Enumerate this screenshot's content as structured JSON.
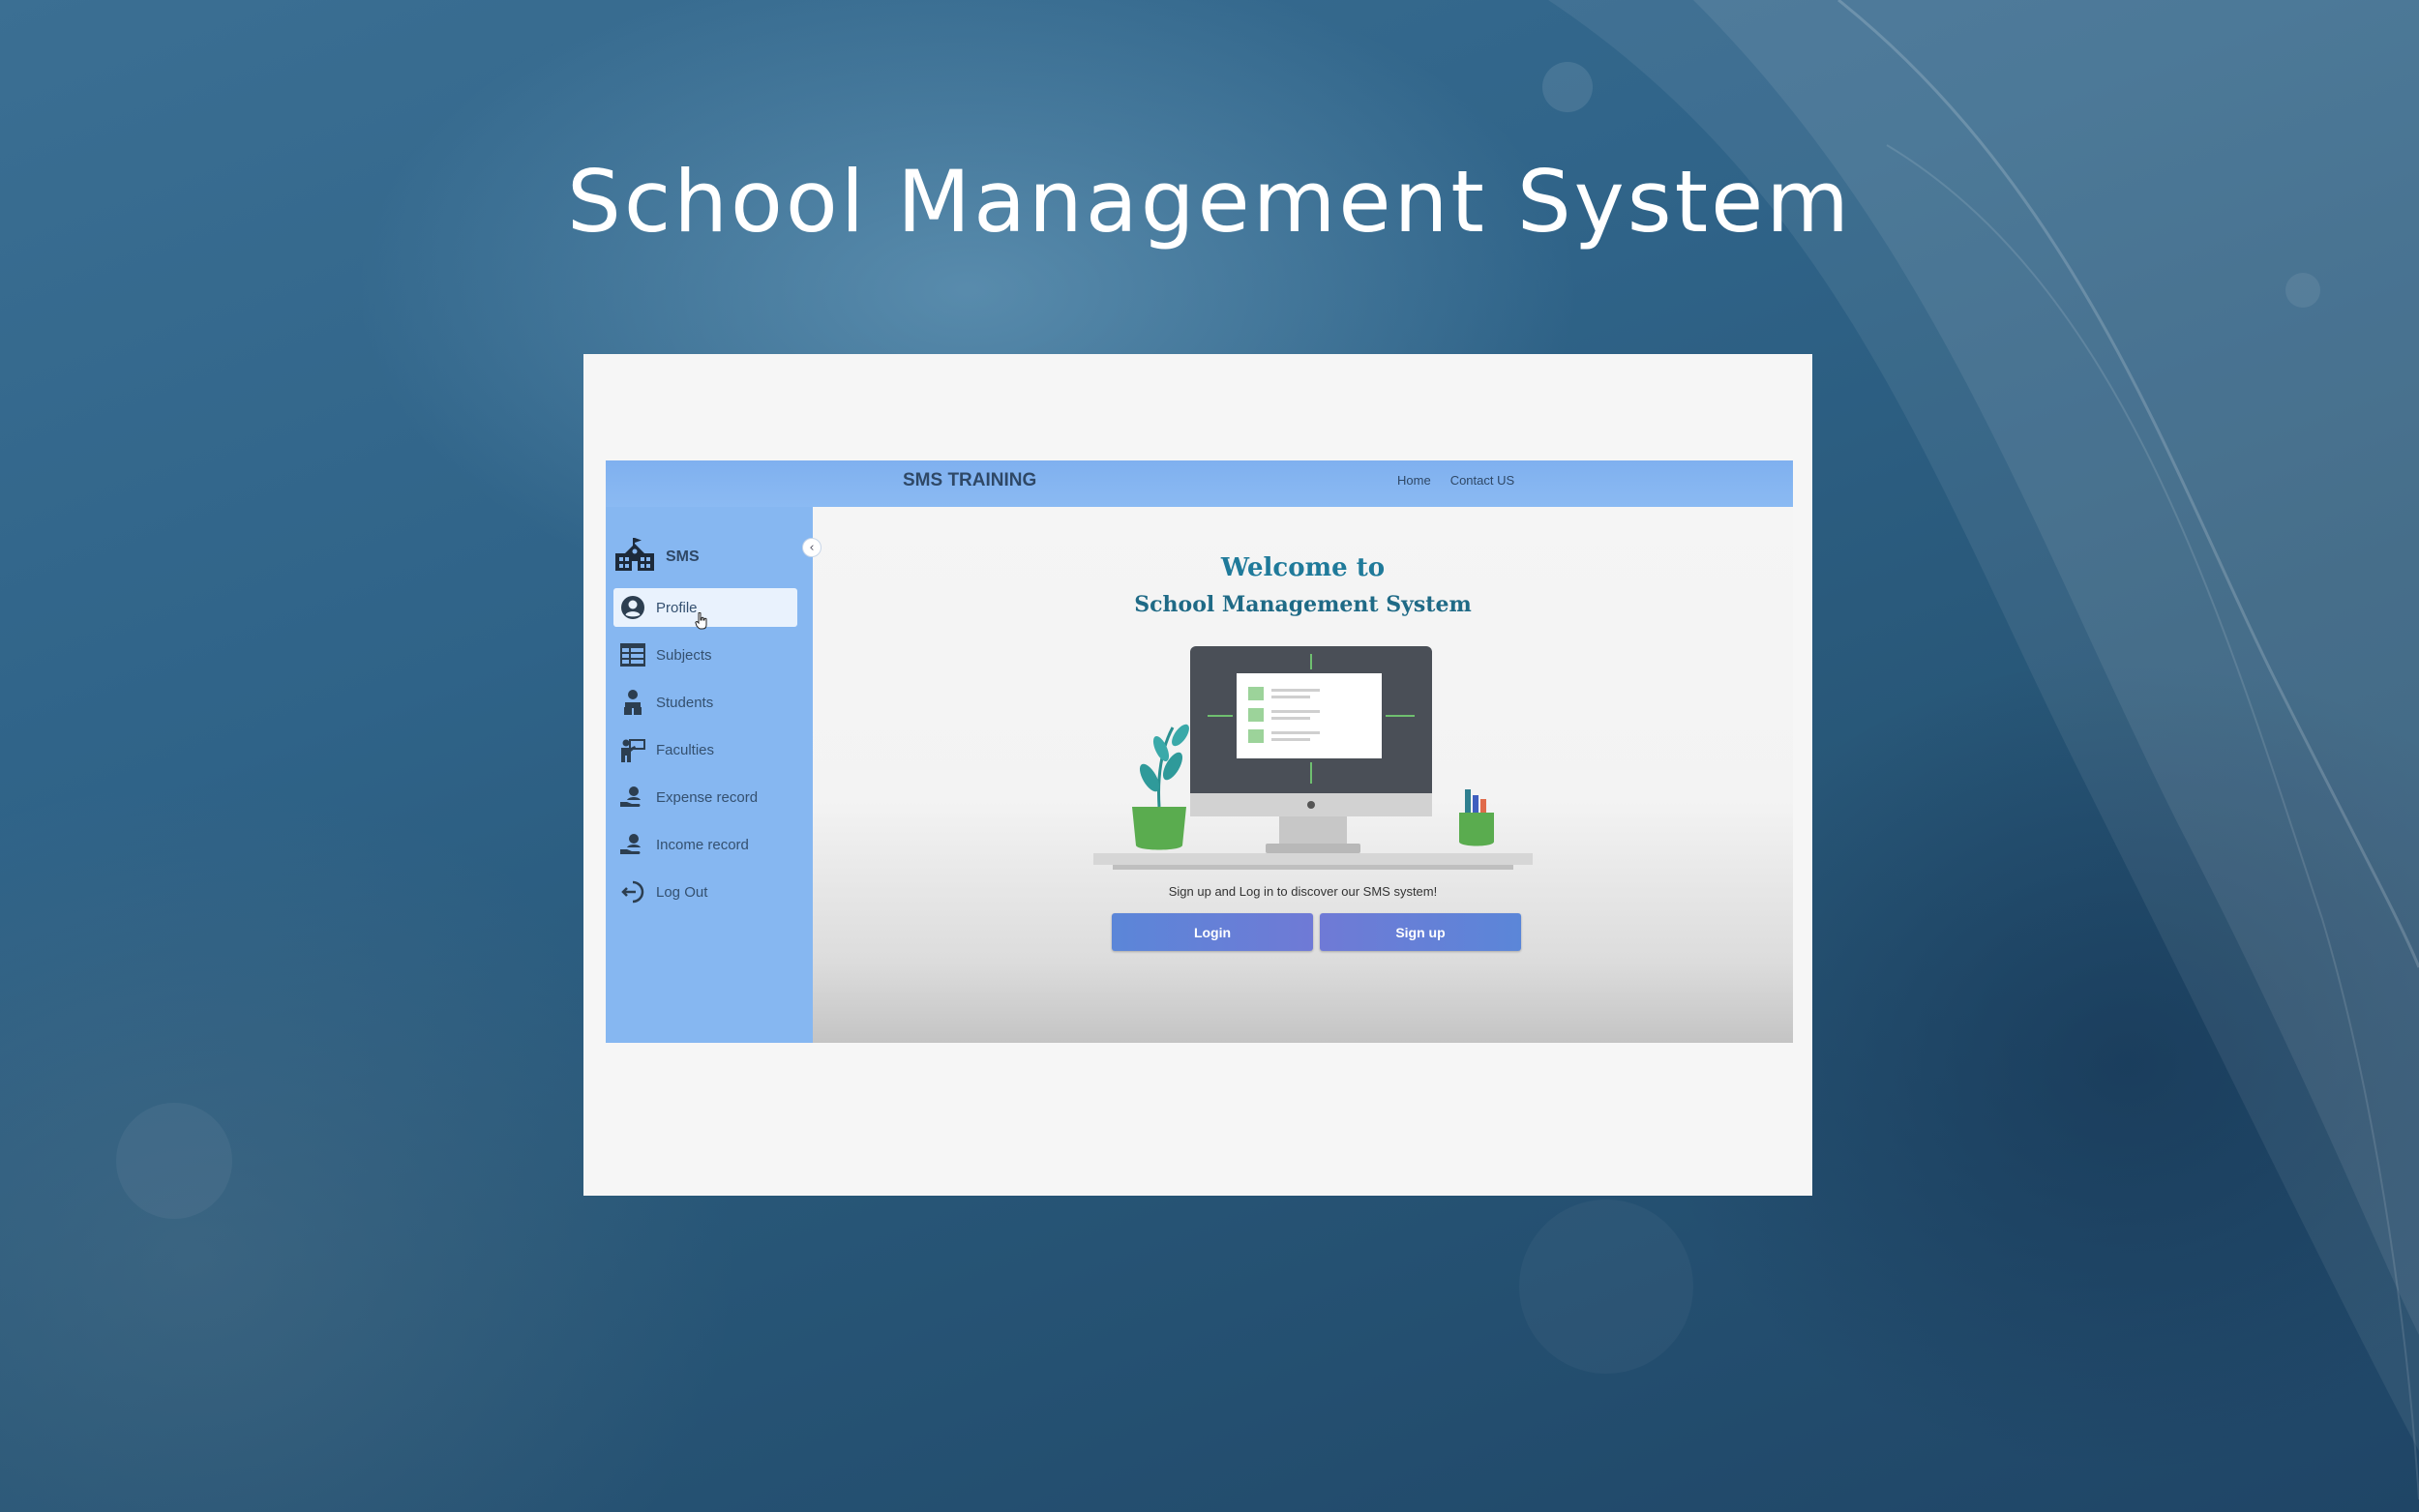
{
  "slide": {
    "title": "School Management System"
  },
  "app": {
    "brand": "SMS TRAINING",
    "nav": [
      "Home",
      "Contact US"
    ],
    "sidebar": {
      "logo_text": "SMS",
      "items": [
        {
          "label": "Profile",
          "icon": "user-circle-icon",
          "active": true
        },
        {
          "label": "Subjects",
          "icon": "table-icon",
          "active": false
        },
        {
          "label": "Students",
          "icon": "students-icon",
          "active": false
        },
        {
          "label": "Faculties",
          "icon": "teacher-icon",
          "active": false
        },
        {
          "label": "Expense record",
          "icon": "hand-user-icon",
          "active": false
        },
        {
          "label": "Income record",
          "icon": "hand-user-icon",
          "active": false
        },
        {
          "label": "Log Out",
          "icon": "logout-icon",
          "active": false
        }
      ]
    },
    "main": {
      "welcome_line1": "Welcome to",
      "welcome_line2": "School Management System",
      "tagline": "Sign up and Log in to discover our SMS system!",
      "login_label": "Login",
      "signup_label": "Sign up"
    }
  },
  "colors": {
    "sidebar": "#86b7f1",
    "topbar": "#7fb0ef",
    "heading": "#1f7a9a",
    "button": "#5b86d8"
  }
}
